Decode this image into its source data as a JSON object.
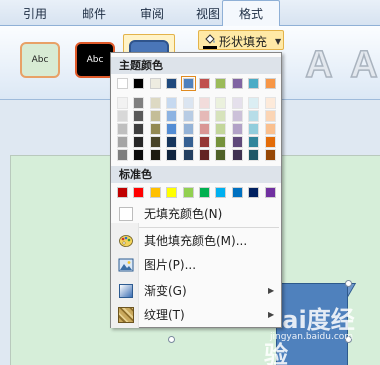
{
  "ribbon": {
    "tabs": [
      {
        "label": "引用"
      },
      {
        "label": "邮件"
      },
      {
        "label": "审阅"
      },
      {
        "label": "视图"
      },
      {
        "label": "格式"
      }
    ],
    "shape_styles": [
      {
        "label": "Abc"
      },
      {
        "label": "Abc"
      },
      {
        "label": ""
      }
    ],
    "fill_button_label": "形状填充",
    "wordart_letters": [
      "A",
      "A"
    ]
  },
  "menu": {
    "theme_header": "主题颜色",
    "standard_header": "标准色",
    "theme_top_row": [
      "#ffffff",
      "#000000",
      "#eeece1",
      "#1f497d",
      "#4f81bd",
      "#c0504d",
      "#9bbb59",
      "#8064a2",
      "#4bacc6",
      "#f79646"
    ],
    "theme_shades": [
      [
        "#f2f2f2",
        "#d8d8d8",
        "#bfbfbf",
        "#a5a5a5",
        "#7f7f7f"
      ],
      [
        "#7f7f7f",
        "#595959",
        "#3f3f3f",
        "#262626",
        "#0c0c0c"
      ],
      [
        "#ddd9c3",
        "#c4bd97",
        "#938953",
        "#494429",
        "#1d1b10"
      ],
      [
        "#c6d9f0",
        "#8db3e2",
        "#548dd4",
        "#17365d",
        "#0f243e"
      ],
      [
        "#dbe5f1",
        "#b8cce4",
        "#95b3d7",
        "#366092",
        "#244061"
      ],
      [
        "#f2dcdb",
        "#e5b9b7",
        "#d99694",
        "#953734",
        "#632423"
      ],
      [
        "#ebf1dd",
        "#d7e3bc",
        "#c3d69b",
        "#76923c",
        "#4f6128"
      ],
      [
        "#e5e0ec",
        "#ccc1d9",
        "#b2a2c7",
        "#5f497a",
        "#3f3151"
      ],
      [
        "#dbeef3",
        "#b7dde8",
        "#92cddc",
        "#31859b",
        "#205867"
      ],
      [
        "#fdeada",
        "#fbd5b5",
        "#fac08f",
        "#e36c09",
        "#974806"
      ]
    ],
    "standard_colors": [
      "#c00000",
      "#ff0000",
      "#ffc000",
      "#ffff00",
      "#92d050",
      "#00b050",
      "#00b0f0",
      "#0070c0",
      "#002060",
      "#7030a0"
    ],
    "selected_theme_index": 4,
    "items": [
      {
        "label": "无填充颜色(N)",
        "icon": "no-fill-swatch-icon"
      },
      {
        "label": "其他填充颜色(M)...",
        "icon": "color-palette-icon"
      },
      {
        "label": "图片(P)...",
        "icon": "picture-icon"
      },
      {
        "label": "渐变(G)",
        "icon": "gradient-icon"
      },
      {
        "label": "纹理(T)",
        "icon": "texture-icon"
      }
    ]
  },
  "watermark": {
    "line1": "Bai度经验",
    "line2": "jingyan.baidu.com"
  }
}
